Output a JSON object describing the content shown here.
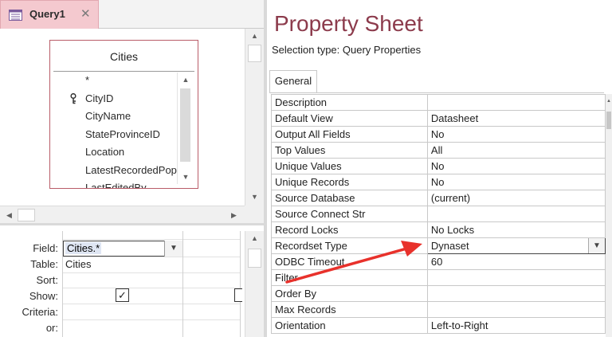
{
  "tab": {
    "label": "Query1",
    "close_glyph": "✕"
  },
  "table": {
    "title": "Cities",
    "fields": [
      "*",
      "CityID",
      "CityName",
      "StateProvinceID",
      "Location",
      "LatestRecordedPop",
      "LastEditedBy"
    ]
  },
  "grid": {
    "row_labels": [
      "Field:",
      "Table:",
      "Sort:",
      "Show:",
      "Criteria:",
      "or:"
    ],
    "field_value": "Cities.*",
    "table_value": "Cities",
    "show_checked": true
  },
  "property_sheet": {
    "title": "Property Sheet",
    "selection_type": "Selection type:  Query Properties",
    "tab_label": "General",
    "properties": [
      {
        "name": "Description",
        "value": ""
      },
      {
        "name": "Default View",
        "value": "Datasheet"
      },
      {
        "name": "Output All Fields",
        "value": "No"
      },
      {
        "name": "Top Values",
        "value": "All"
      },
      {
        "name": "Unique Values",
        "value": "No"
      },
      {
        "name": "Unique Records",
        "value": "No"
      },
      {
        "name": "Source Database",
        "value": "(current)"
      },
      {
        "name": "Source Connect Str",
        "value": ""
      },
      {
        "name": "Record Locks",
        "value": "No Locks"
      },
      {
        "name": "Recordset Type",
        "value": "Dynaset"
      },
      {
        "name": "ODBC Timeout",
        "value": "60"
      },
      {
        "name": "Filter",
        "value": ""
      },
      {
        "name": "Order By",
        "value": ""
      },
      {
        "name": "Max Records",
        "value": ""
      },
      {
        "name": "Orientation",
        "value": "Left-to-Right"
      }
    ]
  },
  "colors": {
    "accent_tab": "#f4c9cf",
    "title_color": "#8c3b4c",
    "arrow": "#e8312b"
  },
  "icons": {
    "query_tab": "query-design-icon",
    "primary_key": "key-icon",
    "dropdown": "chevron-down-icon"
  }
}
